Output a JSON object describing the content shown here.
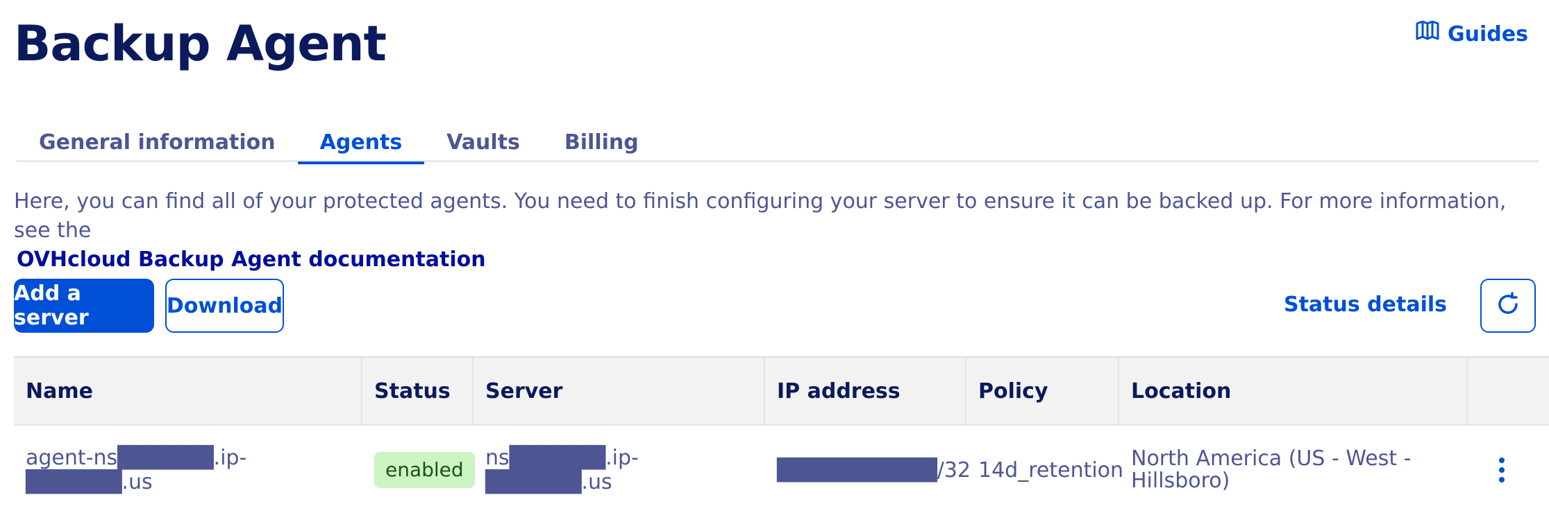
{
  "page": {
    "title": "Backup Agent"
  },
  "header": {
    "guides_label": "Guides",
    "guides_icon": "book-icon"
  },
  "tabs": [
    {
      "label": "General information",
      "active": false
    },
    {
      "label": "Agents",
      "active": true
    },
    {
      "label": "Vaults",
      "active": false
    },
    {
      "label": "Billing",
      "active": false
    }
  ],
  "intro": {
    "text": "Here, you can find all of your protected agents. You need to finish configuring your server to ensure it can be backed up. For more information, see the",
    "link": "OVHcloud Backup Agent documentation"
  },
  "actions": {
    "add_server": "Add a server",
    "download": "Download",
    "status_details": "Status details",
    "refresh_icon": "refresh-icon"
  },
  "table": {
    "headers": [
      "Name",
      "Status",
      "Server",
      "IP address",
      "Policy",
      "Location",
      ""
    ],
    "rows": [
      {
        "name": "agent-ns██████.ip-██████.us",
        "status": "enabled",
        "server": "ns██████.ip-██████.us",
        "ip": "██████████/32",
        "policy": "14d_retention",
        "location": "North America (US - West - Hillsboro)"
      }
    ]
  },
  "colors": {
    "accent": "#0050d7",
    "title": "#0a1a5c",
    "text": "#4d5693",
    "badge_bg": "#cdf4c3"
  }
}
